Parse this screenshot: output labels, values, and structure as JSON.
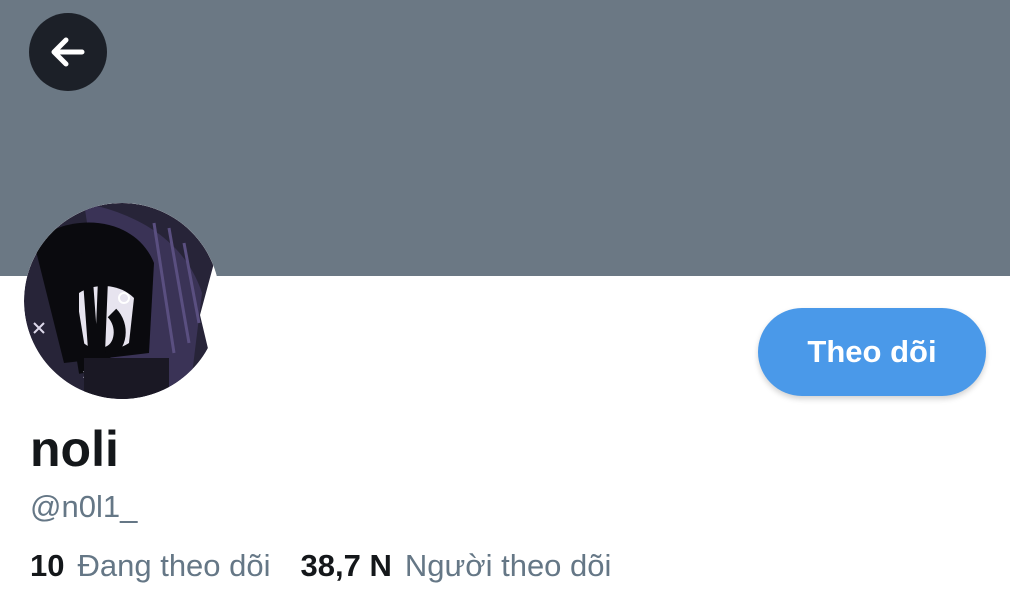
{
  "header": {
    "back_icon": "arrow-left-icon",
    "banner_color": "#6b7884"
  },
  "profile": {
    "display_name": "noli",
    "handle": "@n0l1_",
    "follow_label": "Theo dõi",
    "accent_color": "#4a99e9"
  },
  "stats": {
    "following_count": "10",
    "following_label": "Đang theo dõi",
    "followers_count": "38,7 N",
    "followers_label": "Người theo dõi"
  }
}
